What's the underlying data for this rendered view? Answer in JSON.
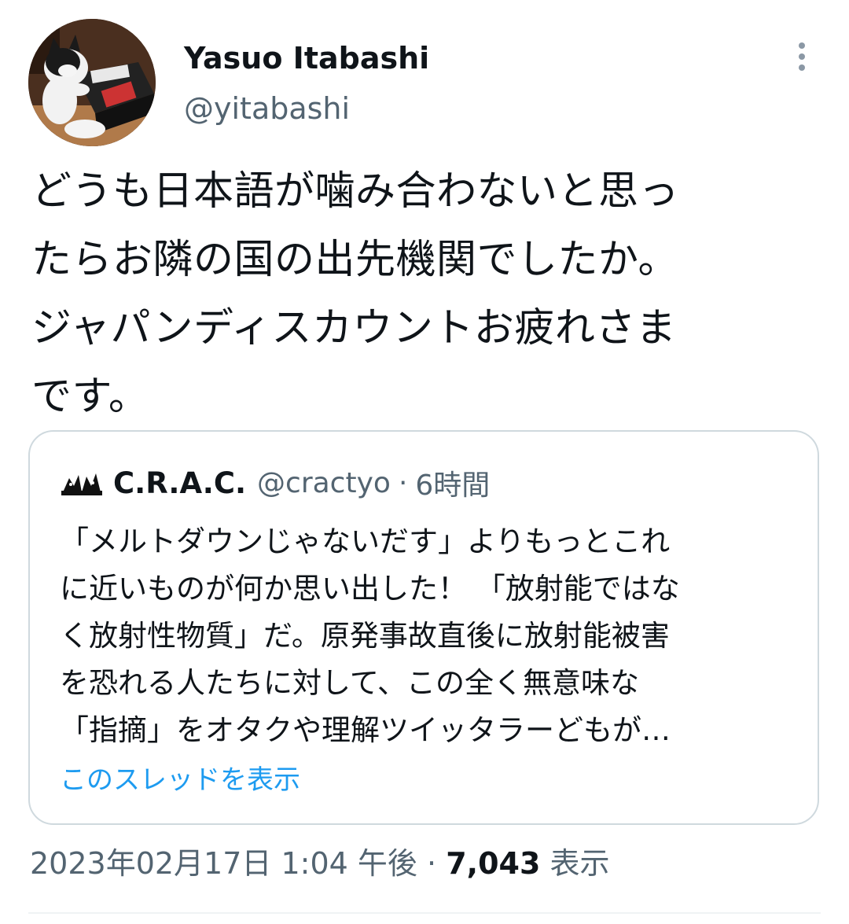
{
  "author": {
    "display_name": "Yasuo Itabashi",
    "handle": "@yitabashi",
    "avatar_icon": "cat-on-fax-machine-avatar"
  },
  "more_icon": "more-vertical-icon",
  "tweet": {
    "lines": [
      "どうも日本語が噛み合わないと思っ",
      "たらお隣の国の出先機関でしたか。",
      "ジャパンディスカウントお疲れさま",
      "です。"
    ]
  },
  "quote": {
    "avatar_icon": "crac-logo-icon",
    "name": "C.R.A.C.",
    "handle": "@cractyo",
    "separator": "·",
    "time": "6時間",
    "lines": [
      "「メルトダウンじゃないだす」よりもっとこれ",
      "に近いものが何か思い出した！ 「放射能ではな",
      "く放射性物質」だ。原発事故直後に放射能被害",
      "を恐れる人たちに対して、この全く無意味な",
      "「指摘」をオタクや理解ツイッタラーどもが…"
    ],
    "thread_link": "このスレッドを表示"
  },
  "meta": {
    "timestamp": "2023年02月17日 1:04 午後",
    "separator": "·",
    "views_count": "7,043",
    "views_label": "表示"
  },
  "colors": {
    "text": "#0f1419",
    "secondary": "#536471",
    "link": "#1d9bf0",
    "border": "#cfd9de"
  }
}
